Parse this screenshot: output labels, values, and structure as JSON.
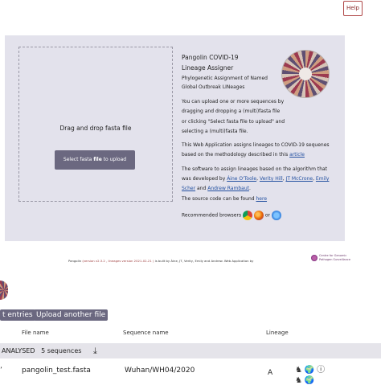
{
  "help_button": "Help",
  "dropzone": {
    "title": "Drag and drop fasta file",
    "button_pre": "Select fasta",
    "button_bold": "file",
    "button_post": "to upload"
  },
  "info": {
    "app_title_1": "Pangolin COVID-19",
    "app_title_2": "Lineage Assigner",
    "subtitle_1": "Phylogenetic Assignment of Named",
    "subtitle_2": "Global Outbreak LINeages",
    "upload_text": "You can upload one or more sequences by dragging and dropping a (multi)fasta file or clicking \"Select fasta file to upload\" and selecting a (multi)fasta file.",
    "method_text": "This Web Application assigns lineages to COVID-19 sequenes based on the methodology described in this",
    "article_link": "article",
    "software_text": "The software to assign lineages based on the algorithm that was developed by",
    "author_1": "Áine O'Toole",
    "comma_1": ",",
    "author_2": "Verity Hill",
    "comma_2": ",",
    "author_3": "JT McCrone",
    "comma_3": ",",
    "author_4": "Emily Scher",
    "and_text": "and",
    "author_5": "Andrew Rambaut",
    "period": ".",
    "source_text": "The source code can be found",
    "source_link": "here",
    "browsers_text": "Recommended browsers",
    "or_text": "or"
  },
  "footer": {
    "pangolin": "Pangolin",
    "version_text": "(version v2.3.2 , lineages version 2021-02-21 )",
    "built_by": "is built by Áine, JT, Verity, Emily and Andrew. Web Application by",
    "cgps_1": "Centre for Genomic",
    "cgps_2": "Pathogen Surveillance"
  },
  "actions": {
    "export_entries": "t entries",
    "upload_another": "Upload another file"
  },
  "table": {
    "headers": [
      "File name",
      "Sequence name",
      "Lineage"
    ],
    "analysed_label": "ANALYSED",
    "analysed_count": "5 sequences",
    "rows": [
      {
        "file": "pangolin_test.fasta",
        "sequence": "Wuhan/WH04/2020",
        "lineage": "A"
      }
    ]
  },
  "icons": {
    "download": "download-icon",
    "chrome": "chrome-icon",
    "firefox": "firefox-icon",
    "safari": "safari-icon",
    "lineage_tree": "lineage-tree-icon",
    "globe": "globe-icon",
    "info": "info-icon"
  }
}
